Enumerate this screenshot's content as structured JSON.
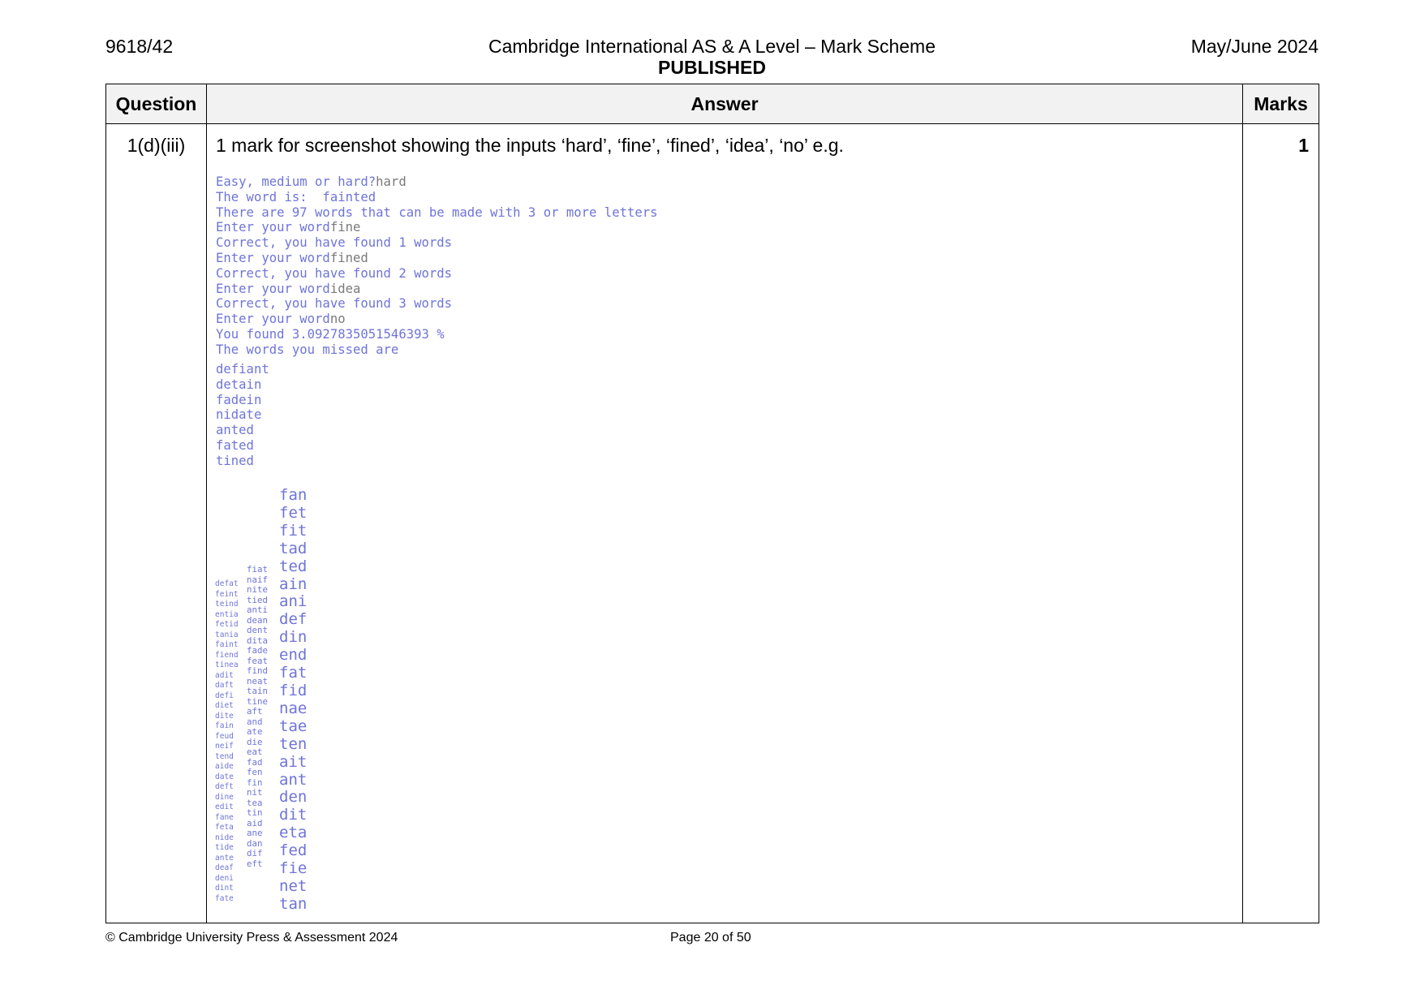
{
  "header": {
    "code": "9618/42",
    "title": "Cambridge International AS & A Level – Mark Scheme",
    "status": "PUBLISHED",
    "session": "May/June 2024"
  },
  "table": {
    "col_question": "Question",
    "col_answer": "Answer",
    "col_marks": "Marks",
    "row": {
      "question": "1(d)(iii)",
      "instruction": "1 mark for screenshot showing the inputs ‘hard’, ‘fine’, ‘fined’, ‘idea’, ‘no’ e.g.",
      "marks": "1"
    }
  },
  "console": {
    "lines": [
      {
        "prompt": "Easy, medium or hard?",
        "input": "hard"
      },
      {
        "prompt": "The word is:  fainted",
        "input": ""
      },
      {
        "prompt": "There are 97 words that can be made with 3 or more letters",
        "input": ""
      },
      {
        "prompt": "Enter your word",
        "input": "fine"
      },
      {
        "prompt": "Correct, you have found 1 words",
        "input": ""
      },
      {
        "prompt": "Enter your word",
        "input": "fined"
      },
      {
        "prompt": "Correct, you have found 2 words",
        "input": ""
      },
      {
        "prompt": "Enter your word",
        "input": "idea"
      },
      {
        "prompt": "Correct, you have found 3 words",
        "input": ""
      },
      {
        "prompt": "Enter your word",
        "input": "no"
      },
      {
        "prompt": "You found 3.0927835051546393 %",
        "input": ""
      },
      {
        "prompt": "The words you missed are",
        "input": ""
      }
    ],
    "missed_words": [
      "defiant",
      "detain",
      "fadein",
      "nidate",
      "anted",
      "fated",
      "tined"
    ],
    "column_a": [
      "defat",
      "feint",
      "teind",
      "entia",
      "fetid",
      "tania",
      "faint",
      "fiend",
      "tinea",
      "adit",
      "daft",
      "defi",
      "diet",
      "dite",
      "fain",
      "feud",
      "neif",
      "tend",
      "aide",
      "date",
      "deft",
      "dine",
      "edit",
      "fane",
      "feta",
      "nide",
      "tide",
      "ante",
      "deaf",
      "deni",
      "dint",
      "fate"
    ],
    "column_b": [
      "fiat",
      "naif",
      "nite",
      "tied",
      "anti",
      "dean",
      "dent",
      "dita",
      "fade",
      "feat",
      "find",
      "neat",
      "tain",
      "tine",
      "aft",
      "and",
      "ate",
      "die",
      "eat",
      "fad",
      "fen",
      "fin",
      "nit",
      "tea",
      "tin",
      "aid",
      "ane",
      "dan",
      "dif",
      "eft"
    ],
    "column_c": [
      "fan",
      "fet",
      "fit",
      "tad",
      "ted",
      "ain",
      "ani",
      "def",
      "din",
      "end",
      "fat",
      "fid",
      "nae",
      "tae",
      "ten",
      "ait",
      "ant",
      "den",
      "dit",
      "eta",
      "fed",
      "fie",
      "net",
      "tan"
    ]
  },
  "footer": {
    "copyright": "© Cambridge University Press & Assessment 2024",
    "page": "Page 20 of 50"
  }
}
